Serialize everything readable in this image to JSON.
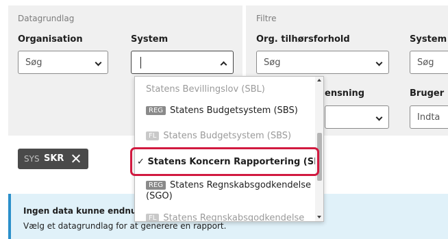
{
  "datagrundlag": {
    "section_label": "Datagrundlag",
    "organisation": {
      "label": "Organisation",
      "value": "Søg"
    },
    "system": {
      "label": "System",
      "value": ""
    }
  },
  "filtre": {
    "section_label": "Filtre",
    "org_tilhoersforhold": {
      "label": "Org. tilhørsforhold",
      "value": "Søg"
    },
    "system_label_partial": "System",
    "system_value_partial": "Søg",
    "licensing_label_partial": "ensning",
    "bruger_label_partial": "Bruger",
    "bruger_value_partial": "Indta"
  },
  "active_filter": {
    "prefix": "SYS",
    "code": "SKR"
  },
  "info": {
    "title_partial": "Ingen data kunne endnu",
    "text": "Vælg et datagrundlag for at generere en rapport."
  },
  "dropdown": {
    "options": [
      {
        "badge": "",
        "text": "Statens Bevillingslov (SBL)",
        "state": "dim"
      },
      {
        "badge": "REG",
        "text": "Statens Budgetsystem (SBS)",
        "state": "normal"
      },
      {
        "badge": "FL",
        "text": "Statens Budgetsystem (SBS)",
        "state": "dim"
      },
      {
        "badge": "",
        "check": "✓",
        "text": "Statens Koncern Rapportering (SKR)",
        "state": "selected"
      },
      {
        "badge": "REG",
        "text_line1": "Statens Regnskabsgodkendelse",
        "text_line2": "(SGO)",
        "state": "normal"
      },
      {
        "badge": "FL",
        "text": "Statens Regnskabsgodkendelse",
        "state": "dim"
      }
    ]
  },
  "colors": {
    "panel": "#f0f0f0",
    "selected_outline": "#d1193f",
    "chip_bg": "#4a4a4a",
    "info_bg": "#e0f1f9",
    "info_border": "#2a8fca"
  }
}
